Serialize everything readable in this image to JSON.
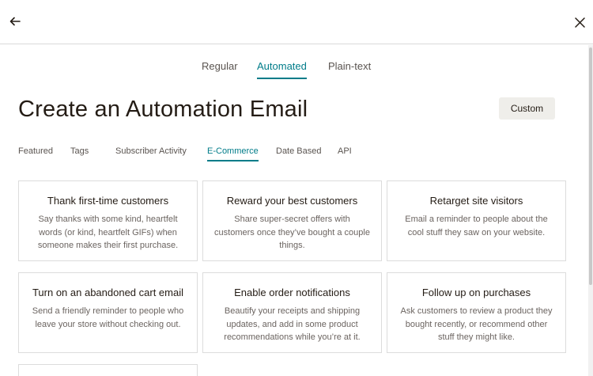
{
  "nav": {
    "back_icon": "arrow-left-icon",
    "close_icon": "close-icon"
  },
  "type_tabs": [
    {
      "label": "Regular",
      "active": false
    },
    {
      "label": "Automated",
      "active": true
    },
    {
      "label": "Plain-text",
      "active": false
    }
  ],
  "title": "Create an Automation Email",
  "custom_button": "Custom",
  "category_tabs": [
    {
      "label": "Featured",
      "active": false
    },
    {
      "label": "Tags",
      "active": false
    },
    {
      "label": "Subscriber Activity",
      "active": false
    },
    {
      "label": "E-Commerce",
      "active": true
    },
    {
      "label": "Date Based",
      "active": false
    },
    {
      "label": "API",
      "active": false
    }
  ],
  "cards": [
    {
      "title": "Thank first-time customers",
      "description": "Say thanks with some kind, heartfelt words (or kind, heartfelt GIFs) when someone makes their first purchase."
    },
    {
      "title": "Reward your best customers",
      "description": "Share super-secret offers with customers once they’ve bought a couple things."
    },
    {
      "title": "Retarget site visitors",
      "description": "Email a reminder to people about the cool stuff they saw on your website."
    },
    {
      "title": "Turn on an abandoned cart email",
      "description": "Send a friendly reminder to people who leave your store without checking out."
    },
    {
      "title": "Enable order notifications",
      "description": "Beautify your receipts and shipping updates, and add in some product recommendations while you’re at it."
    },
    {
      "title": "Follow up on purchases",
      "description": "Ask customers to review a product they bought recently, or recommend other stuff they might like."
    }
  ],
  "colors": {
    "accent": "#007c89",
    "text": "#241c15",
    "muted": "#6b6460",
    "button_bg": "#efeeea",
    "border": "#dcdcdc"
  }
}
